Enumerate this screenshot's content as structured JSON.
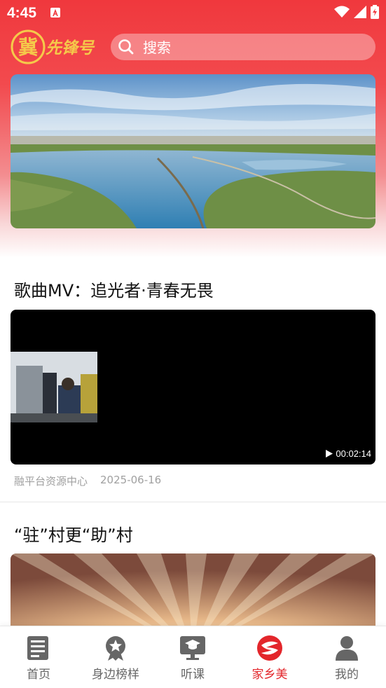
{
  "status_bar": {
    "time": "4:45"
  },
  "header": {
    "logo_text": "冀先锋号",
    "search": {
      "placeholder": "搜索"
    }
  },
  "articles": [
    {
      "title": "歌曲MV：追光者·青春无畏",
      "duration": "00:02:14",
      "source": "融平台资源中心",
      "date": "2025-06-16"
    },
    {
      "title": "“驻”村更“助”村"
    }
  ],
  "tabbar": {
    "items": [
      {
        "label": "首页",
        "icon": "news-icon",
        "active": false
      },
      {
        "label": "身边榜样",
        "icon": "star-badge-icon",
        "active": false
      },
      {
        "label": "听课",
        "icon": "lecture-screen-icon",
        "active": false
      },
      {
        "label": "家乡美",
        "icon": "hometown-logo-icon",
        "active": true
      },
      {
        "label": "我的",
        "icon": "user-icon",
        "active": false
      }
    ]
  },
  "colors": {
    "brand_red": "#e3262b",
    "tab_gray": "#666666",
    "meta_gray": "#a0a0a0"
  }
}
